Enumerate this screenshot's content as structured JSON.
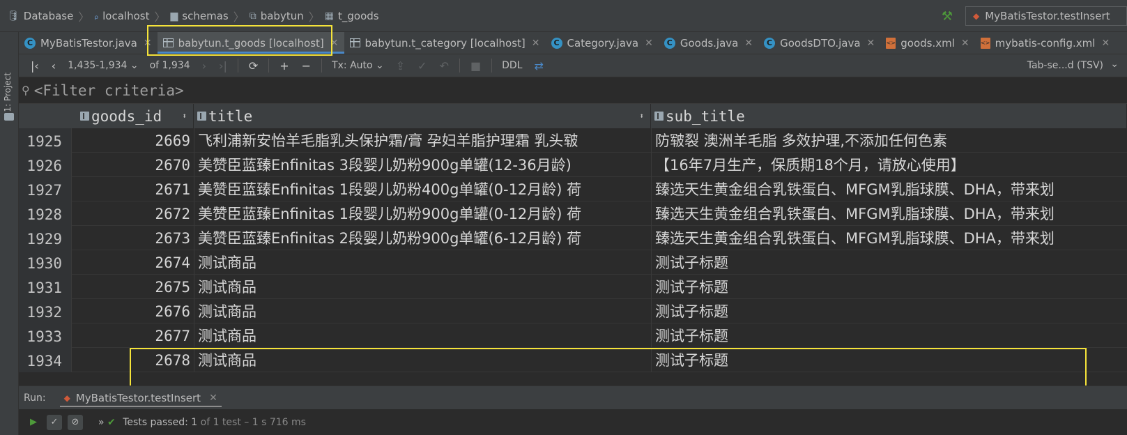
{
  "breadcrumb": [
    {
      "label": "Database",
      "icon": "database-icon"
    },
    {
      "label": "localhost",
      "icon": "datasource-icon"
    },
    {
      "label": "schemas",
      "icon": "folder-icon"
    },
    {
      "label": "babytun",
      "icon": "schema-icon"
    },
    {
      "label": "t_goods",
      "icon": "table-icon"
    }
  ],
  "run_config": {
    "label": "MyBatisTestor.testInsert"
  },
  "left_strip": {
    "project_label": "1: Project"
  },
  "tabs": [
    {
      "label": "MyBatisTestor.java",
      "icon": "class-icon"
    },
    {
      "label": "babytun.t_goods [localhost]",
      "icon": "table-icon",
      "active": true
    },
    {
      "label": "babytun.t_category [localhost]",
      "icon": "table-icon"
    },
    {
      "label": "Category.java",
      "icon": "class-icon"
    },
    {
      "label": "Goods.java",
      "icon": "class-icon"
    },
    {
      "label": "GoodsDTO.java",
      "icon": "class-icon"
    },
    {
      "label": "goods.xml",
      "icon": "xml-icon"
    },
    {
      "label": "mybatis-config.xml",
      "icon": "xml-icon"
    }
  ],
  "toolbar": {
    "range": "1,435-1,934",
    "of_total": "of 1,934",
    "tx_mode": "Tx: Auto",
    "ddl": "DDL",
    "export_format": "Tab-se...d (TSV)"
  },
  "filter": {
    "placeholder": "<Filter criteria>"
  },
  "table": {
    "columns": [
      "goods_id",
      "title",
      "sub_title"
    ],
    "rows": [
      {
        "num": "1925",
        "goods_id": "2669",
        "title": "飞利浦新安怡羊毛脂乳头保护霜/膏 孕妇羊脂护理霜 乳头皲",
        "sub_title": "防皲裂 澳洲羊毛脂 多效护理,不添加任何色素"
      },
      {
        "num": "1926",
        "goods_id": "2670",
        "title": "美赞臣蓝臻Enfinitas 3段婴儿奶粉900g单罐(12-36月龄)",
        "sub_title": "【16年7月生产，保质期18个月，请放心使用】"
      },
      {
        "num": "1927",
        "goods_id": "2671",
        "title": "美赞臣蓝臻Enfinitas 1段婴儿奶粉400g单罐(0-12月龄) 荷",
        "sub_title": "臻选天生黄金组合乳铁蛋白、MFGM乳脂球膜、DHA，带来划"
      },
      {
        "num": "1928",
        "goods_id": "2672",
        "title": "美赞臣蓝臻Enfinitas 1段婴儿奶粉900g单罐(0-12月龄) 荷",
        "sub_title": "臻选天生黄金组合乳铁蛋白、MFGM乳脂球膜、DHA，带来划"
      },
      {
        "num": "1929",
        "goods_id": "2673",
        "title": "美赞臣蓝臻Enfinitas 2段婴儿奶粉900g单罐(6-12月龄) 荷",
        "sub_title": "臻选天生黄金组合乳铁蛋白、MFGM乳脂球膜、DHA，带来划"
      },
      {
        "num": "1930",
        "goods_id": "2674",
        "title": "测试商品",
        "sub_title": "测试子标题"
      },
      {
        "num": "1931",
        "goods_id": "2675",
        "title": "测试商品",
        "sub_title": "测试子标题"
      },
      {
        "num": "1932",
        "goods_id": "2676",
        "title": "测试商品",
        "sub_title": "测试子标题"
      },
      {
        "num": "1933",
        "goods_id": "2677",
        "title": "测试商品",
        "sub_title": "测试子标题"
      },
      {
        "num": "1934",
        "goods_id": "2678",
        "title": "测试商品",
        "sub_title": "测试子标题"
      }
    ]
  },
  "run_panel": {
    "label": "Run:",
    "tab_label": "MyBatisTestor.testInsert",
    "status_prefix": "»",
    "status_passed": "Tests passed: 1",
    "status_detail": "of 1 test – 1 s 716 ms"
  },
  "colors": {
    "highlight": "#f5e33a",
    "active_tab_underline": "#4a88c7",
    "pass_green": "#4e9a3a",
    "run_icon": "#d05a3a"
  }
}
